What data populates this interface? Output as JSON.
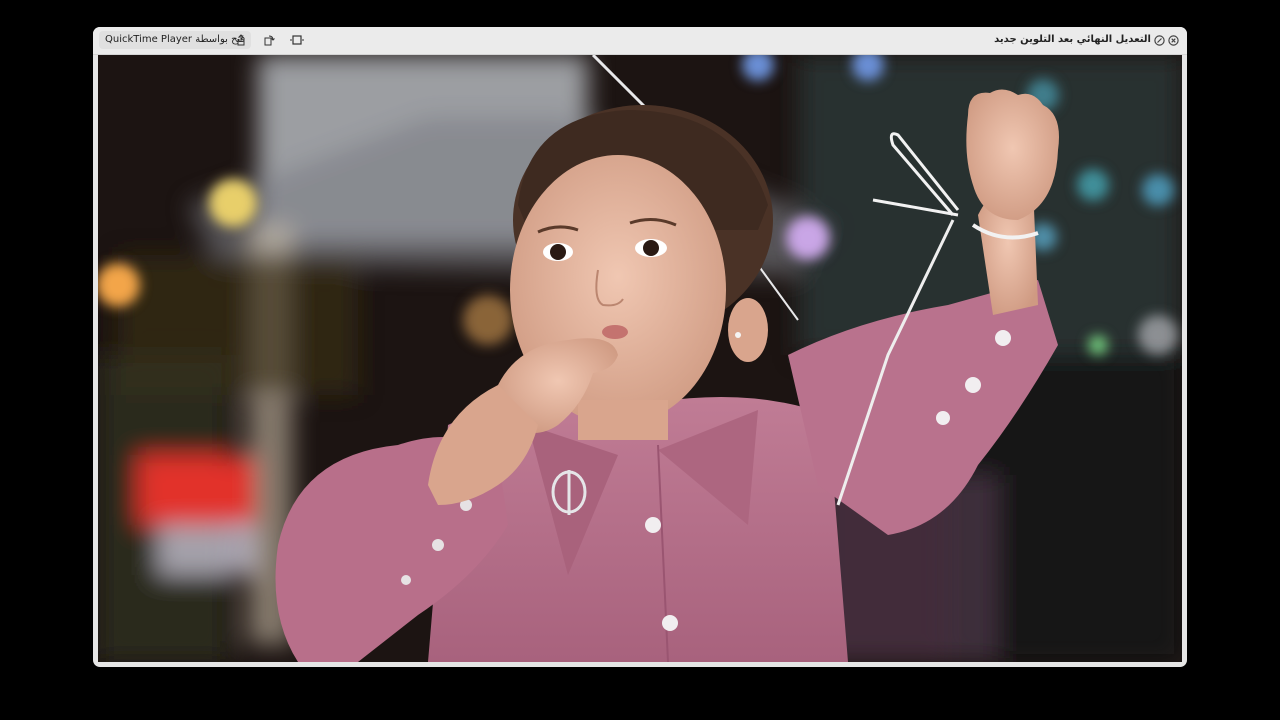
{
  "window": {
    "title": "التعديل النهائي بعد التلوين جديد",
    "open_with_label": "فتح بواسطة QuickTime Player"
  },
  "toolbar": {
    "icons": [
      "share-icon",
      "rotate-icon",
      "trim-icon"
    ]
  },
  "controls": {
    "icons": [
      "close-icon",
      "fullscreen-icon"
    ]
  },
  "video": {
    "description_icon": "video-frame",
    "dominant_colors": {
      "shirt": "#b5708a",
      "background": "#1a120f",
      "skin": "#e8b9a3"
    }
  }
}
